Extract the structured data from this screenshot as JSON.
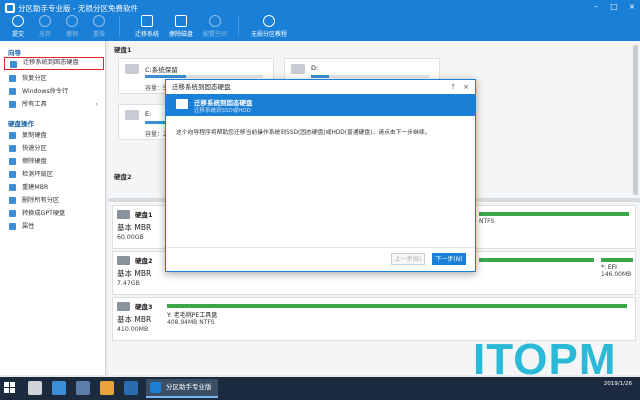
{
  "window": {
    "title": "分区助手专业版 - 无损分区免费软件"
  },
  "toolbar": {
    "items": [
      {
        "label": "提交"
      },
      {
        "label": "放弃"
      },
      {
        "label": "撤销"
      },
      {
        "label": "重做"
      },
      {
        "label": "迁移系统"
      },
      {
        "label": "擦除磁盘"
      },
      {
        "label": "配置空间"
      },
      {
        "label": "无损分区教程"
      }
    ]
  },
  "sidebar": {
    "wizard_title": "向导",
    "wizard_items": [
      {
        "label": "迁移系统到固态硬盘"
      },
      {
        "label": "恢复分区"
      },
      {
        "label": "Windows命令行"
      },
      {
        "label": "所有工具"
      }
    ],
    "disk_ops_title": "硬盘操作",
    "disk_ops_items": [
      {
        "label": "复制硬盘"
      },
      {
        "label": "快速分区"
      },
      {
        "label": "擦除硬盘"
      },
      {
        "label": "检测坏扇区"
      },
      {
        "label": "重建MBR"
      },
      {
        "label": "删除所有分区"
      },
      {
        "label": "转换成GPT硬盘"
      },
      {
        "label": "属性"
      }
    ]
  },
  "main": {
    "disk1_header": "硬盘1",
    "disk2_header": "硬盘2",
    "partitions": [
      {
        "name": "C:系统保留",
        "cap": "容量：579.0"
      },
      {
        "name": "D:",
        "cap": ""
      },
      {
        "name": "E:",
        "cap": "容量：23.7"
      }
    ],
    "disks": [
      {
        "name": "硬盘1",
        "type": "基本 MBR",
        "size": "60.00GB",
        "part_label": "",
        "part_detail": "NTFS"
      },
      {
        "name": "硬盘2",
        "type": "基本 MBR",
        "size": "7.47GB",
        "part_label": "*: EFI",
        "part_detail": "146.00MB"
      },
      {
        "name": "硬盘3",
        "type": "基本 MBR",
        "size": "410.00MB",
        "part_label": "Y: 老毛桃PE工具盘",
        "part_detail": "408.94MB NTFS"
      }
    ]
  },
  "dialog": {
    "title": "迁移系统到固态硬盘",
    "header_title": "迁移系统到固态硬盘",
    "header_sub": "迁移系统到SSD或HDD",
    "body": "这个向导程序将帮助您迁移当前操作系统到SSD(固态硬盘)或HDD(普通硬盘)，请点击下一步继续。",
    "prev_label": "上一步(B)",
    "next_label": "下一步(N)",
    "help": "?",
    "close": "×"
  },
  "watermark": "ITOPM",
  "taskbar": {
    "app_label": "分区助手专业版",
    "time": "2019/1/26"
  },
  "colors": {
    "accent": "#1a7fd6",
    "highlight": "#e0262b",
    "partition_bar": "#3aa64a",
    "watermark": "#2bb9d8"
  }
}
